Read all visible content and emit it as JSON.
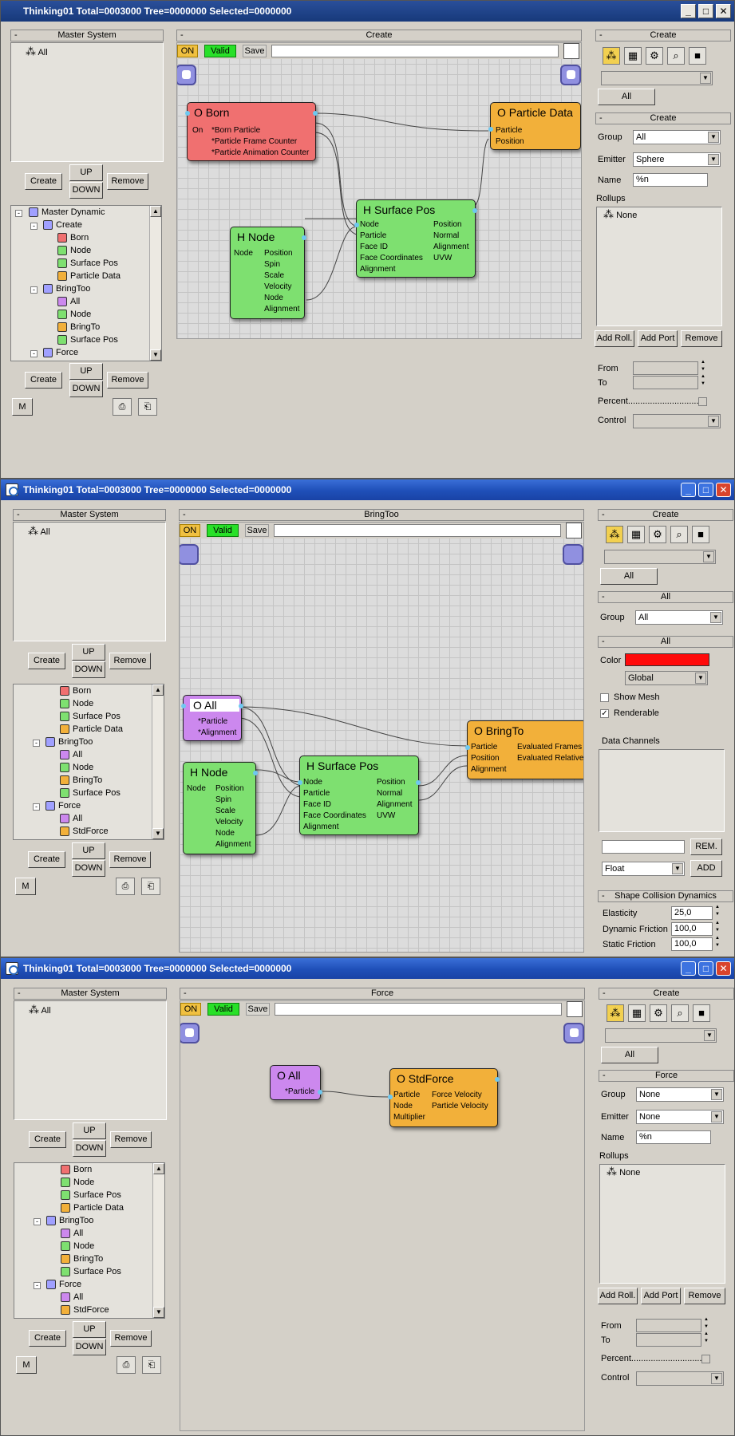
{
  "windows": [
    {
      "title": "Thinking01  Total=0003000  Tree=0000000  Selected=0000000",
      "master_system": {
        "header": "Master System",
        "items": [
          "All"
        ]
      },
      "buttons": {
        "create": "Create",
        "up": "UP",
        "down": "DOWN",
        "remove": "Remove",
        "m": "M"
      },
      "tree": [
        "Master Dynamic",
        "Create",
        "Born",
        "Node",
        "Surface Pos",
        "Particle Data",
        "BringToo",
        "All",
        "Node",
        "BringTo",
        "Surface Pos",
        "Force"
      ],
      "canvas": {
        "header": "Create",
        "toolbar": {
          "on": "ON",
          "valid": "Valid",
          "save": "Save"
        },
        "nodes": [
          {
            "title": "O Born",
            "lines": [
              "On",
              "*Born Particle",
              "*Particle Frame Counter",
              "*Particle Animation Counter"
            ]
          },
          {
            "title": "O Particle Data",
            "lines": [
              "Particle",
              "Position"
            ]
          },
          {
            "title": "H Surface Pos",
            "left": [
              "Node",
              "Particle",
              "Face ID",
              "Face Coordinates",
              "Alignment"
            ],
            "right": [
              "Position",
              "Normal",
              "Alignment",
              "UVW"
            ]
          },
          {
            "title": "H Node",
            "left": [
              "Node"
            ],
            "right": [
              "Position",
              "Spin",
              "Scale",
              "Velocity",
              "Node",
              "Alignment"
            ]
          }
        ]
      },
      "right": {
        "create_header": "Create",
        "all_button": "All",
        "sub_header": "Create",
        "group_label": "Group",
        "group_value": "All",
        "emitter_label": "Emitter",
        "emitter_value": "Sphere",
        "name_label": "Name",
        "name_value": "%n",
        "rollups_label": "Rollups",
        "rollups_item": "None",
        "add_roll": "Add Roll.",
        "add_port": "Add Port",
        "remove": "Remove",
        "from_label": "From",
        "to_label": "To",
        "percent_label": "Percent.............................",
        "control_label": "Control"
      }
    },
    {
      "title": "Thinking01  Total=0003000  Tree=0000000  Selected=0000000",
      "master_system": {
        "header": "Master System",
        "items": [
          "All"
        ]
      },
      "buttons": {
        "create": "Create",
        "up": "UP",
        "down": "DOWN",
        "remove": "Remove",
        "m": "M"
      },
      "tree": [
        "Born",
        "Node",
        "Surface Pos",
        "Particle Data",
        "BringToo",
        "All",
        "Node",
        "BringTo",
        "Surface Pos",
        "Force",
        "All",
        "StdForce"
      ],
      "canvas": {
        "header": "BringToo",
        "toolbar": {
          "on": "ON",
          "valid": "Valid",
          "save": "Save"
        },
        "nodes": [
          {
            "title": "O All",
            "lines": [
              "*Particle",
              "*Alignment"
            ]
          },
          {
            "title": "O BringTo",
            "left": [
              "Particle",
              "Position",
              "Alignment"
            ],
            "right": [
              "Evaluated Frames",
              "Evaluated Relative"
            ]
          },
          {
            "title": "H Surface Pos",
            "left": [
              "Node",
              "Particle",
              "Face ID",
              "Face Coordinates",
              "Alignment"
            ],
            "right": [
              "Position",
              "Normal",
              "Alignment",
              "UVW"
            ]
          },
          {
            "title": "H Node",
            "left": [
              "Node"
            ],
            "right": [
              "Position",
              "Spin",
              "Scale",
              "Velocity",
              "Node",
              "Alignment"
            ]
          }
        ]
      },
      "right": {
        "create_header": "Create",
        "all_button": "All",
        "sub_header": "All",
        "group_label": "Group",
        "group_value": "All",
        "sub_header2": "All",
        "color_label": "Color",
        "color_value": "#ff0a0a",
        "global_value": "Global",
        "show_mesh": "Show Mesh",
        "renderable": "Renderable",
        "data_channels": "Data Channels",
        "rem": "REM.",
        "float_value": "Float",
        "add": "ADD",
        "shape_header": "Shape Collision Dynamics",
        "elasticity_label": "Elasticity",
        "elasticity_value": "25,0",
        "dyn_label": "Dynamic Friction",
        "dyn_value": "100,0",
        "static_label": "Static Friction",
        "static_value": "100,0"
      }
    },
    {
      "title": "Thinking01  Total=0003000  Tree=0000000  Selected=0000000",
      "master_system": {
        "header": "Master System",
        "items": [
          "All"
        ]
      },
      "buttons": {
        "create": "Create",
        "up": "UP",
        "down": "DOWN",
        "remove": "Remove",
        "m": "M"
      },
      "tree": [
        "Born",
        "Node",
        "Surface Pos",
        "Particle Data",
        "BringToo",
        "All",
        "Node",
        "BringTo",
        "Surface Pos",
        "Force",
        "All",
        "StdForce"
      ],
      "canvas": {
        "header": "Force",
        "toolbar": {
          "on": "ON",
          "valid": "Valid",
          "save": "Save"
        },
        "nodes": [
          {
            "title": "O All",
            "lines": [
              "*Particle"
            ]
          },
          {
            "title": "O StdForce",
            "left": [
              "Particle",
              "Node",
              "Multiplier"
            ],
            "right": [
              "Force Velocity",
              "Particle Velocity"
            ]
          }
        ]
      },
      "right": {
        "create_header": "Create",
        "all_button": "All",
        "sub_header": "Force",
        "group_label": "Group",
        "group_value": "None",
        "emitter_label": "Emitter",
        "emitter_value": "None",
        "name_label": "Name",
        "name_value": "%n",
        "rollups_label": "Rollups",
        "rollups_item": "None",
        "add_roll": "Add Roll.",
        "add_port": "Add Port",
        "remove": "Remove",
        "from_label": "From",
        "to_label": "To",
        "percent_label": "Percent.............................",
        "control_label": "Control"
      }
    }
  ],
  "colors": {
    "born": "#f07070",
    "orange": "#f2b03a",
    "green": "#7ee070",
    "purple": "#cc88ee",
    "valid": "#28e028",
    "on": "#f0c040"
  }
}
